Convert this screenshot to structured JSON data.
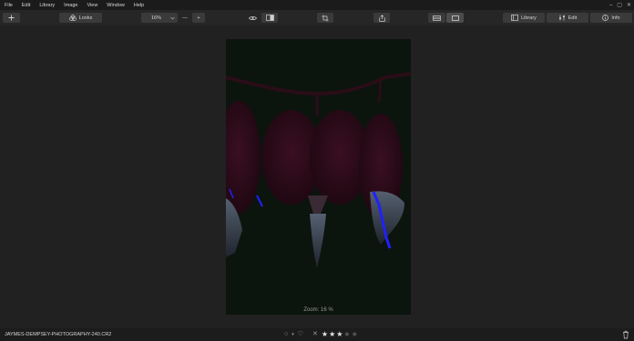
{
  "menu": [
    "File",
    "Edit",
    "Library",
    "Image",
    "View",
    "Window",
    "Help"
  ],
  "window_controls": [
    "–",
    "▢",
    "✕"
  ],
  "toolbar": {
    "looks_label": "Looks",
    "zoom_value": "16%",
    "zoom_minus": "—",
    "zoom_plus": "+",
    "library_label": "Library",
    "edit_label": "Edit",
    "info_label": "Info"
  },
  "canvas": {
    "zoom_text": "Zoom: 16 %"
  },
  "status": {
    "filename": "JAYMES-DEMPSEY-PHOTOGRAPHY-240.CR2",
    "rating": 3,
    "rating_max": 5
  }
}
